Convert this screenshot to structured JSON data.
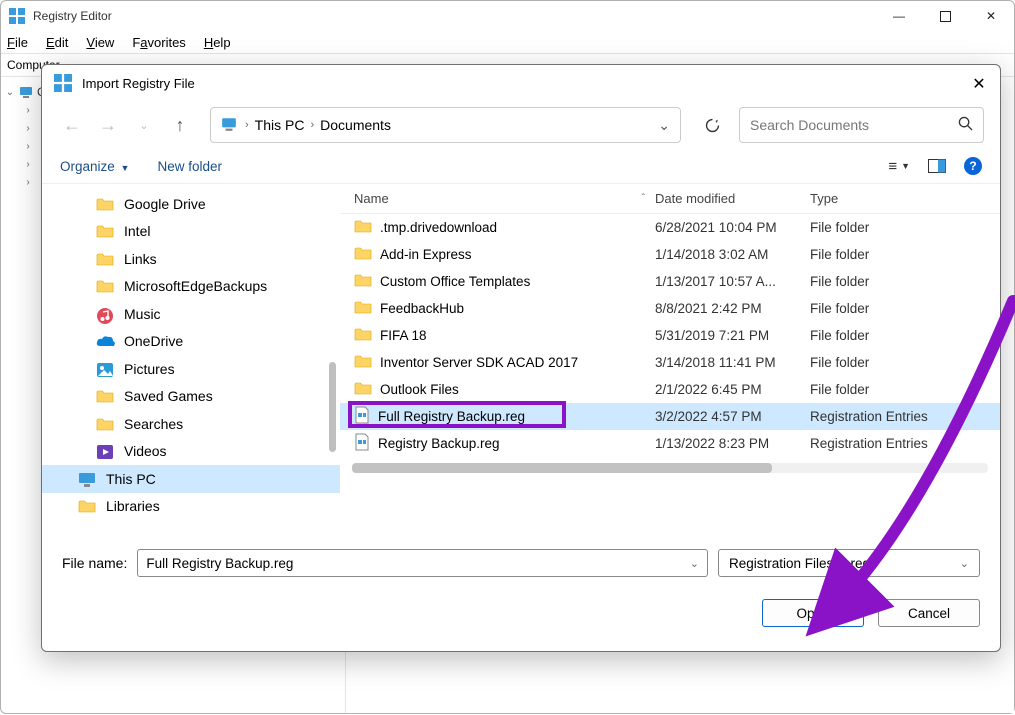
{
  "regedit": {
    "title": "Registry Editor",
    "menu": {
      "file": "File",
      "edit": "Edit",
      "view": "View",
      "favorites": "Favorites",
      "help": "Help"
    },
    "address_label": "Computer",
    "tree_root": "Computer"
  },
  "dialog": {
    "title": "Import Registry File",
    "breadcrumb": {
      "root": "This PC",
      "folder": "Documents"
    },
    "search_placeholder": "Search Documents",
    "toolbar": {
      "organize": "Organize",
      "newfolder": "New folder"
    },
    "sidebar": [
      {
        "icon": "folder",
        "label": "Google Drive"
      },
      {
        "icon": "folder",
        "label": "Intel"
      },
      {
        "icon": "folder",
        "label": "Links"
      },
      {
        "icon": "folder",
        "label": "MicrosoftEdgeBackups"
      },
      {
        "icon": "music",
        "label": "Music"
      },
      {
        "icon": "onedrive",
        "label": "OneDrive"
      },
      {
        "icon": "pictures",
        "label": "Pictures"
      },
      {
        "icon": "folder",
        "label": "Saved Games"
      },
      {
        "icon": "folder",
        "label": "Searches"
      },
      {
        "icon": "videos",
        "label": "Videos"
      },
      {
        "icon": "thispc",
        "label": "This PC",
        "selected": true,
        "indent": true
      },
      {
        "icon": "folder",
        "label": "Libraries",
        "indent": true
      }
    ],
    "columns": {
      "name": "Name",
      "date": "Date modified",
      "type": "Type"
    },
    "files": [
      {
        "icon": "folder",
        "name": ".tmp.drivedownload",
        "date": "6/28/2021 10:04 PM",
        "type": "File folder"
      },
      {
        "icon": "folder",
        "name": "Add-in Express",
        "date": "1/14/2018 3:02 AM",
        "type": "File folder"
      },
      {
        "icon": "folder",
        "name": "Custom Office Templates",
        "date": "1/13/2017 10:57 A...",
        "type": "File folder"
      },
      {
        "icon": "folder",
        "name": "FeedbackHub",
        "date": "8/8/2021 2:42 PM",
        "type": "File folder"
      },
      {
        "icon": "folder",
        "name": "FIFA 18",
        "date": "5/31/2019 7:21 PM",
        "type": "File folder"
      },
      {
        "icon": "folder",
        "name": "Inventor Server SDK ACAD 2017",
        "date": "3/14/2018 11:41 PM",
        "type": "File folder"
      },
      {
        "icon": "folder",
        "name": "Outlook Files",
        "date": "2/1/2022 6:45 PM",
        "type": "File folder"
      },
      {
        "icon": "reg",
        "name": "Full Registry Backup.reg",
        "date": "3/2/2022 4:57 PM",
        "type": "Registration Entries",
        "selected": true,
        "highlight": true
      },
      {
        "icon": "reg",
        "name": "Registry Backup.reg",
        "date": "1/13/2022 8:23 PM",
        "type": "Registration Entries"
      }
    ],
    "filename_label": "File name:",
    "filename_value": "Full Registry Backup.reg",
    "filter": "Registration Files (*.reg)",
    "open": "Open",
    "cancel": "Cancel"
  },
  "annotation": {
    "arrow_color": "#8a12c7"
  }
}
